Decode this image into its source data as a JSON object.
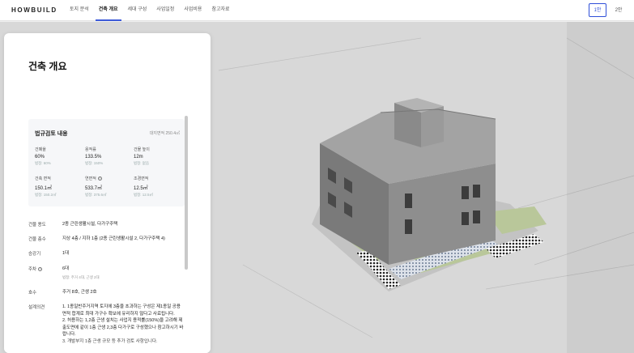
{
  "app": {
    "logo": "HOWBUILD"
  },
  "nav": {
    "tabs": [
      {
        "label": "토지 분석"
      },
      {
        "label": "건축 개요"
      },
      {
        "label": "세대 구성"
      },
      {
        "label": "사업일정"
      },
      {
        "label": "사업비용"
      },
      {
        "label": "참고자료"
      }
    ],
    "active_tab": "건축 개요",
    "plans": [
      {
        "label": "1안"
      },
      {
        "label": "2안"
      }
    ],
    "active_plan": "1안"
  },
  "panel": {
    "title": "건축 개요",
    "review": {
      "heading": "법규검토 내용",
      "site_area": "대지면적 250.4㎡",
      "metrics": [
        {
          "label": "건폐율",
          "value": "60%",
          "sub": "법정: 60%"
        },
        {
          "label": "용적률",
          "value": "133.5%",
          "sub": "법정: 150%"
        },
        {
          "label": "건물 높이",
          "value": "12m",
          "sub": "법정: 없음"
        },
        {
          "label": "건축 면적",
          "value": "150.1㎡",
          "sub": "법정: 150.2㎡"
        },
        {
          "label": "연면적",
          "value": "533.7㎡",
          "sub": "법정: 375.6㎡"
        },
        {
          "label": "조경면적",
          "value": "12.5㎡",
          "sub": "법정: 12.5㎡"
        }
      ]
    },
    "details": [
      {
        "key": "건물 용도",
        "value": "2종 근린생활시설, 다가구주택"
      },
      {
        "key": "건물 층수",
        "value": "지상 4층 / 지하 1층 (2종 근린생활시설 2, 다가구주택 4)"
      },
      {
        "key": "승강기",
        "value": "1대"
      },
      {
        "key": "주차",
        "value": "6대",
        "note": "법정: 주거 4대, 근생 2대"
      },
      {
        "key": "호수",
        "value": "주거 8호, 근생 2호"
      },
      {
        "key": "설계의견",
        "value": "1. 1종일반주거지역 토지에 3층을 초과하는 구성은 제1종일 공용면적 합계로 최대 가구수 확보에 유리하지 않다고 사료됩니다.\n2. 허용하는 1,2층 근생 설치는 사업지 용적률(150%)을 고려해 제출도면에 같이 1층 근생 2,3층 다가구로 구성했으나 참고하시기 바랍니다.\n3. 개발부지 1층 근생 규모 등 추가 검토 사항입니다."
      }
    ]
  },
  "colors": {
    "accent": "#3d5bd9",
    "viewport_bg": "#d8d8d8",
    "building": "#8a8a8a",
    "lawn": "#b9c79a"
  }
}
